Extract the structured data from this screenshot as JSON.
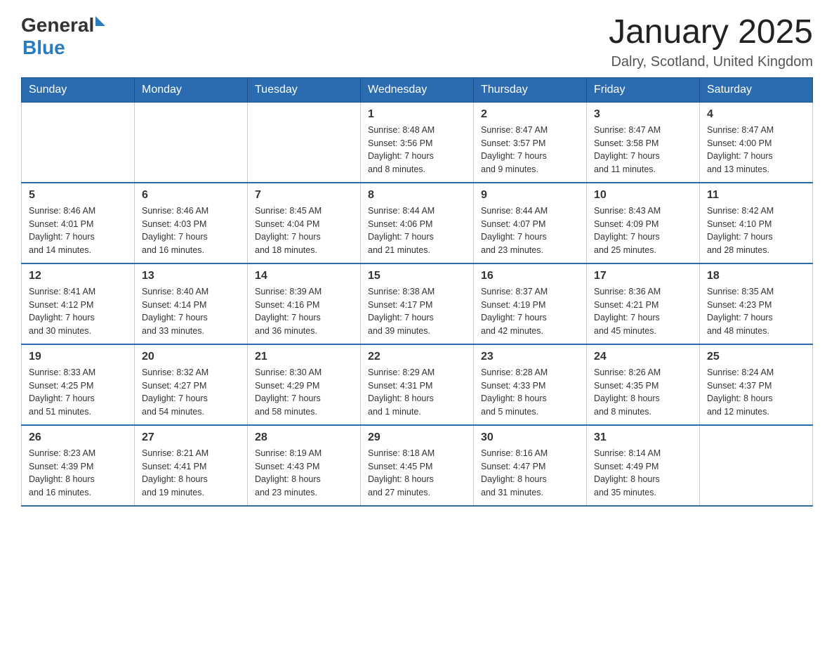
{
  "header": {
    "logo": {
      "general": "General",
      "blue": "Blue"
    },
    "title": "January 2025",
    "subtitle": "Dalry, Scotland, United Kingdom"
  },
  "calendar": {
    "days_of_week": [
      "Sunday",
      "Monday",
      "Tuesday",
      "Wednesday",
      "Thursday",
      "Friday",
      "Saturday"
    ],
    "weeks": [
      [
        {
          "day": "",
          "info": ""
        },
        {
          "day": "",
          "info": ""
        },
        {
          "day": "",
          "info": ""
        },
        {
          "day": "1",
          "info": "Sunrise: 8:48 AM\nSunset: 3:56 PM\nDaylight: 7 hours\nand 8 minutes."
        },
        {
          "day": "2",
          "info": "Sunrise: 8:47 AM\nSunset: 3:57 PM\nDaylight: 7 hours\nand 9 minutes."
        },
        {
          "day": "3",
          "info": "Sunrise: 8:47 AM\nSunset: 3:58 PM\nDaylight: 7 hours\nand 11 minutes."
        },
        {
          "day": "4",
          "info": "Sunrise: 8:47 AM\nSunset: 4:00 PM\nDaylight: 7 hours\nand 13 minutes."
        }
      ],
      [
        {
          "day": "5",
          "info": "Sunrise: 8:46 AM\nSunset: 4:01 PM\nDaylight: 7 hours\nand 14 minutes."
        },
        {
          "day": "6",
          "info": "Sunrise: 8:46 AM\nSunset: 4:03 PM\nDaylight: 7 hours\nand 16 minutes."
        },
        {
          "day": "7",
          "info": "Sunrise: 8:45 AM\nSunset: 4:04 PM\nDaylight: 7 hours\nand 18 minutes."
        },
        {
          "day": "8",
          "info": "Sunrise: 8:44 AM\nSunset: 4:06 PM\nDaylight: 7 hours\nand 21 minutes."
        },
        {
          "day": "9",
          "info": "Sunrise: 8:44 AM\nSunset: 4:07 PM\nDaylight: 7 hours\nand 23 minutes."
        },
        {
          "day": "10",
          "info": "Sunrise: 8:43 AM\nSunset: 4:09 PM\nDaylight: 7 hours\nand 25 minutes."
        },
        {
          "day": "11",
          "info": "Sunrise: 8:42 AM\nSunset: 4:10 PM\nDaylight: 7 hours\nand 28 minutes."
        }
      ],
      [
        {
          "day": "12",
          "info": "Sunrise: 8:41 AM\nSunset: 4:12 PM\nDaylight: 7 hours\nand 30 minutes."
        },
        {
          "day": "13",
          "info": "Sunrise: 8:40 AM\nSunset: 4:14 PM\nDaylight: 7 hours\nand 33 minutes."
        },
        {
          "day": "14",
          "info": "Sunrise: 8:39 AM\nSunset: 4:16 PM\nDaylight: 7 hours\nand 36 minutes."
        },
        {
          "day": "15",
          "info": "Sunrise: 8:38 AM\nSunset: 4:17 PM\nDaylight: 7 hours\nand 39 minutes."
        },
        {
          "day": "16",
          "info": "Sunrise: 8:37 AM\nSunset: 4:19 PM\nDaylight: 7 hours\nand 42 minutes."
        },
        {
          "day": "17",
          "info": "Sunrise: 8:36 AM\nSunset: 4:21 PM\nDaylight: 7 hours\nand 45 minutes."
        },
        {
          "day": "18",
          "info": "Sunrise: 8:35 AM\nSunset: 4:23 PM\nDaylight: 7 hours\nand 48 minutes."
        }
      ],
      [
        {
          "day": "19",
          "info": "Sunrise: 8:33 AM\nSunset: 4:25 PM\nDaylight: 7 hours\nand 51 minutes."
        },
        {
          "day": "20",
          "info": "Sunrise: 8:32 AM\nSunset: 4:27 PM\nDaylight: 7 hours\nand 54 minutes."
        },
        {
          "day": "21",
          "info": "Sunrise: 8:30 AM\nSunset: 4:29 PM\nDaylight: 7 hours\nand 58 minutes."
        },
        {
          "day": "22",
          "info": "Sunrise: 8:29 AM\nSunset: 4:31 PM\nDaylight: 8 hours\nand 1 minute."
        },
        {
          "day": "23",
          "info": "Sunrise: 8:28 AM\nSunset: 4:33 PM\nDaylight: 8 hours\nand 5 minutes."
        },
        {
          "day": "24",
          "info": "Sunrise: 8:26 AM\nSunset: 4:35 PM\nDaylight: 8 hours\nand 8 minutes."
        },
        {
          "day": "25",
          "info": "Sunrise: 8:24 AM\nSunset: 4:37 PM\nDaylight: 8 hours\nand 12 minutes."
        }
      ],
      [
        {
          "day": "26",
          "info": "Sunrise: 8:23 AM\nSunset: 4:39 PM\nDaylight: 8 hours\nand 16 minutes."
        },
        {
          "day": "27",
          "info": "Sunrise: 8:21 AM\nSunset: 4:41 PM\nDaylight: 8 hours\nand 19 minutes."
        },
        {
          "day": "28",
          "info": "Sunrise: 8:19 AM\nSunset: 4:43 PM\nDaylight: 8 hours\nand 23 minutes."
        },
        {
          "day": "29",
          "info": "Sunrise: 8:18 AM\nSunset: 4:45 PM\nDaylight: 8 hours\nand 27 minutes."
        },
        {
          "day": "30",
          "info": "Sunrise: 8:16 AM\nSunset: 4:47 PM\nDaylight: 8 hours\nand 31 minutes."
        },
        {
          "day": "31",
          "info": "Sunrise: 8:14 AM\nSunset: 4:49 PM\nDaylight: 8 hours\nand 35 minutes."
        },
        {
          "day": "",
          "info": ""
        }
      ]
    ]
  }
}
